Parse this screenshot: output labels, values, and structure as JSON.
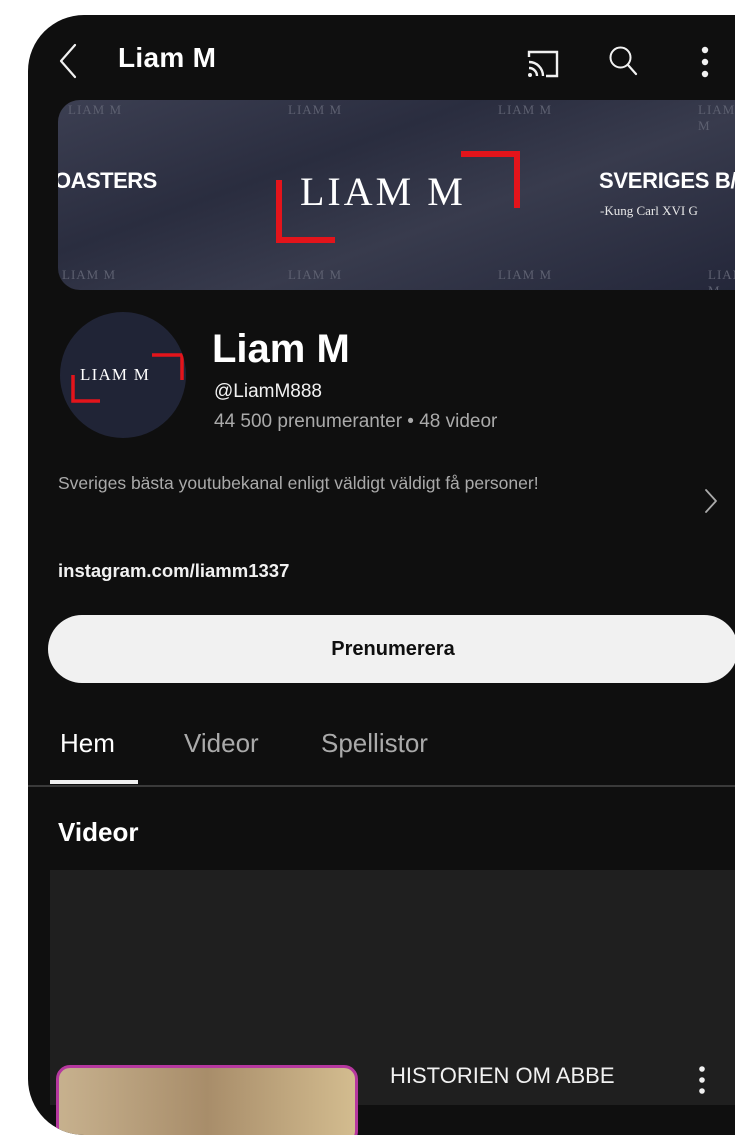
{
  "header": {
    "title": "Liam M",
    "icons": [
      "back-icon",
      "cast-icon",
      "search-icon",
      "more-vert-icon"
    ]
  },
  "banner": {
    "left_text": "OASTERS",
    "logo_text": "LIAM M",
    "right_title": "SVERIGES B/",
    "right_subtitle": "-Kung Carl XVI G",
    "watermark": "LIAM M",
    "accent_color": "#e3141b"
  },
  "channel": {
    "avatar_text": "LIAM M",
    "name": "Liam M",
    "handle": "@LiamM888",
    "stats": "44 500 prenumeranter • 48 videor",
    "description": "Sveriges bästa youtubekanal enligt väldigt väldigt få personer!",
    "link": "instagram.com/liamm1337"
  },
  "subscribe_label": "Prenumerera",
  "tabs": [
    {
      "label": "Hem",
      "active": true
    },
    {
      "label": "Videor",
      "active": false
    },
    {
      "label": "Spellistor",
      "active": false
    }
  ],
  "section": {
    "title": "Videor"
  },
  "video": {
    "title": "HISTORIEN OM ABBE"
  }
}
